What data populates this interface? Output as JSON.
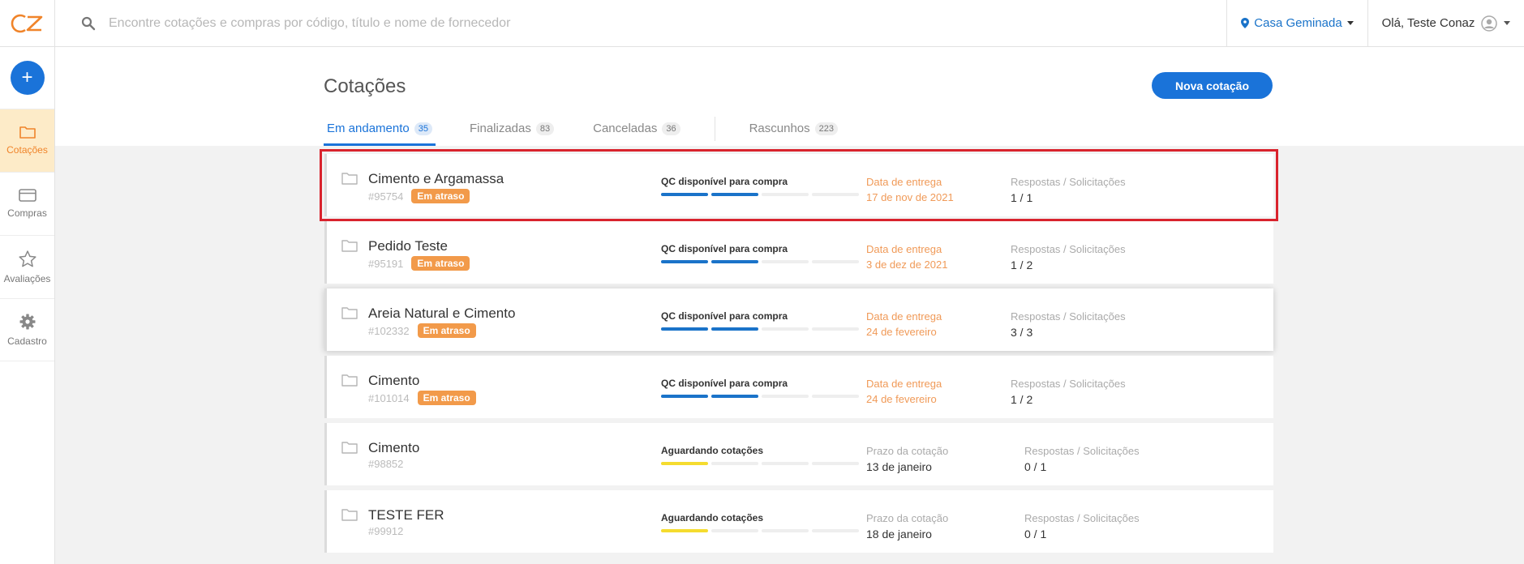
{
  "app": {
    "logo": "CZ"
  },
  "search": {
    "placeholder": "Encontre cotações e compras por código, título e nome de fornecedor"
  },
  "location": {
    "label": "Casa Geminada"
  },
  "user": {
    "greeting": "Olá, Teste Conaz"
  },
  "sidebar": {
    "add_label": "+",
    "items": [
      {
        "label": "Cotações"
      },
      {
        "label": "Compras"
      },
      {
        "label": "Avaliações"
      },
      {
        "label": "Cadastro"
      }
    ]
  },
  "page": {
    "title": "Cotações",
    "new_button": "Nova cotação"
  },
  "tabs": [
    {
      "label": "Em andamento",
      "count": "35"
    },
    {
      "label": "Finalizadas",
      "count": "83"
    },
    {
      "label": "Canceladas",
      "count": "36"
    },
    {
      "label": "Rascunhos",
      "count": "223"
    }
  ],
  "rows": [
    {
      "title": "Cimento e Argamassa",
      "code": "#95754",
      "badge": "Em atraso",
      "status": "QC disponível para compra",
      "progress_filled": 2,
      "date_label": "Data de entrega",
      "date_value": "17 de nov de 2021",
      "resp_label": "Respostas / Solicitações",
      "resp_value": "1 / 1"
    },
    {
      "title": "Pedido Teste",
      "code": "#95191",
      "badge": "Em atraso",
      "status": "QC disponível para compra",
      "progress_filled": 2,
      "date_label": "Data de entrega",
      "date_value": "3 de dez de 2021",
      "resp_label": "Respostas / Solicitações",
      "resp_value": "1 / 2"
    },
    {
      "title": "Areia Natural e Cimento",
      "code": "#102332",
      "badge": "Em atraso",
      "status": "QC disponível para compra",
      "progress_filled": 2,
      "date_label": "Data de entrega",
      "date_value": "24 de fevereiro",
      "resp_label": "Respostas / Solicitações",
      "resp_value": "3 / 3"
    },
    {
      "title": "Cimento",
      "code": "#101014",
      "badge": "Em atraso",
      "status": "QC disponível para compra",
      "progress_filled": 2,
      "date_label": "Data de entrega",
      "date_value": "24 de fevereiro",
      "resp_label": "Respostas / Solicitações",
      "resp_value": "1 / 2"
    },
    {
      "title": "Cimento",
      "code": "#98852",
      "badge": "",
      "status": "Aguardando cotações",
      "progress_filled": 1,
      "date_label": "Prazo da cotação",
      "date_value": "13 de janeiro",
      "resp_label": "Respostas / Solicitações",
      "resp_value": "0 / 1"
    },
    {
      "title": "TESTE FER",
      "code": "#99912",
      "badge": "",
      "status": "Aguardando cotações",
      "progress_filled": 1,
      "date_label": "Prazo da cotação",
      "date_value": "18 de janeiro",
      "resp_label": "Respostas / Solicitações",
      "resp_value": "0 / 1"
    }
  ],
  "colors": {
    "accent": "#1a73d9",
    "active_nav": "#f0842a",
    "late_badge": "#f29a4a",
    "waiting_bar": "#f5dc2f",
    "highlight": "#d9232d"
  }
}
